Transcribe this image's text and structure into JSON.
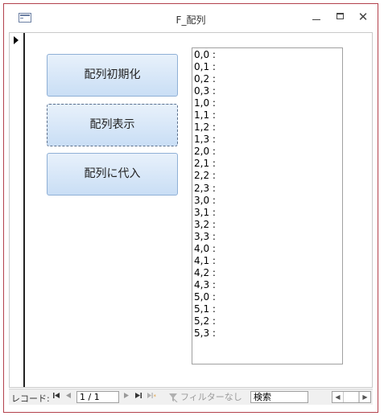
{
  "window": {
    "title": "F_配列"
  },
  "buttons": {
    "init_label": "配列初期化",
    "show_label": "配列表示",
    "assign_label": "配列に代入"
  },
  "list": {
    "items": [
      "0,0 :",
      "0,1 :",
      "0,2 :",
      "0,3 :",
      "1,0 :",
      "1,1 :",
      "1,2 :",
      "1,3 :",
      "2,0 :",
      "2,1 :",
      "2,2 :",
      "2,3 :",
      "3,0 :",
      "3,1 :",
      "3,2 :",
      "3,3 :",
      "4,0 :",
      "4,1 :",
      "4,2 :",
      "4,3 :",
      "5,0 :",
      "5,1 :",
      "5,2 :",
      "5,3 :"
    ]
  },
  "navbar": {
    "record_label": "レコード:",
    "record_value": "1 / 1",
    "filter_label": "フィルターなし",
    "search_value": "検索"
  },
  "icons": {
    "first": "first-record-icon",
    "prev": "previous-record-icon",
    "next": "next-record-icon",
    "last": "last-record-icon",
    "new": "new-record-icon",
    "filter": "filter-icon"
  }
}
